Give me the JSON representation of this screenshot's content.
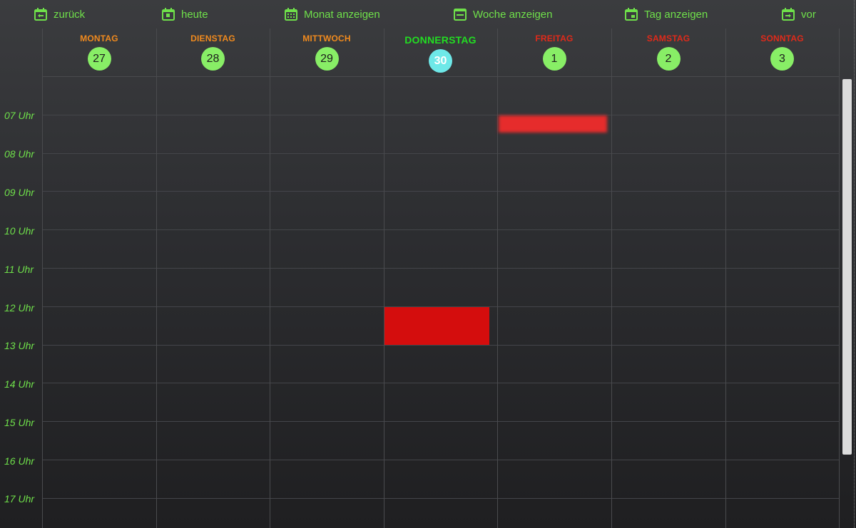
{
  "toolbar": {
    "back": "zurück",
    "today": "heute",
    "month": "Monat anzeigen",
    "week": "Woche anzeigen",
    "day": "Tag anzeigen",
    "forward": "vor"
  },
  "days": [
    {
      "name": "MONTAG",
      "number": "27",
      "color": "#f08a1e",
      "today": false
    },
    {
      "name": "DIENSTAG",
      "number": "28",
      "color": "#f08a1e",
      "today": false
    },
    {
      "name": "MITTWOCH",
      "number": "29",
      "color": "#f08a1e",
      "today": false
    },
    {
      "name": "DONNERSTAG",
      "number": "30",
      "color": "#22dd22",
      "today": true,
      "highlight": "#6ee8e8"
    },
    {
      "name": "FREITAG",
      "number": "1",
      "color": "#e02a1a",
      "today": false
    },
    {
      "name": "SAMSTAG",
      "number": "2",
      "color": "#e02a1a",
      "today": false
    },
    {
      "name": "SONNTAG",
      "number": "3",
      "color": "#e02a1a",
      "today": false
    }
  ],
  "hours": [
    "07 Uhr",
    "08 Uhr",
    "09 Uhr",
    "10 Uhr",
    "11 Uhr",
    "12 Uhr",
    "13 Uhr",
    "14 Uhr",
    "15 Uhr",
    "16 Uhr",
    "17 Uhr"
  ],
  "events": [
    {
      "day": "FREITAG",
      "text": "",
      "color": "#e62c2c"
    },
    {
      "day": "DONNERSTAG",
      "text": "",
      "color": "#d40d0d"
    }
  ],
  "colors": {
    "accent": "#6fe04a",
    "day_circle": "#88ee66",
    "event_red": "#d40d0d"
  }
}
